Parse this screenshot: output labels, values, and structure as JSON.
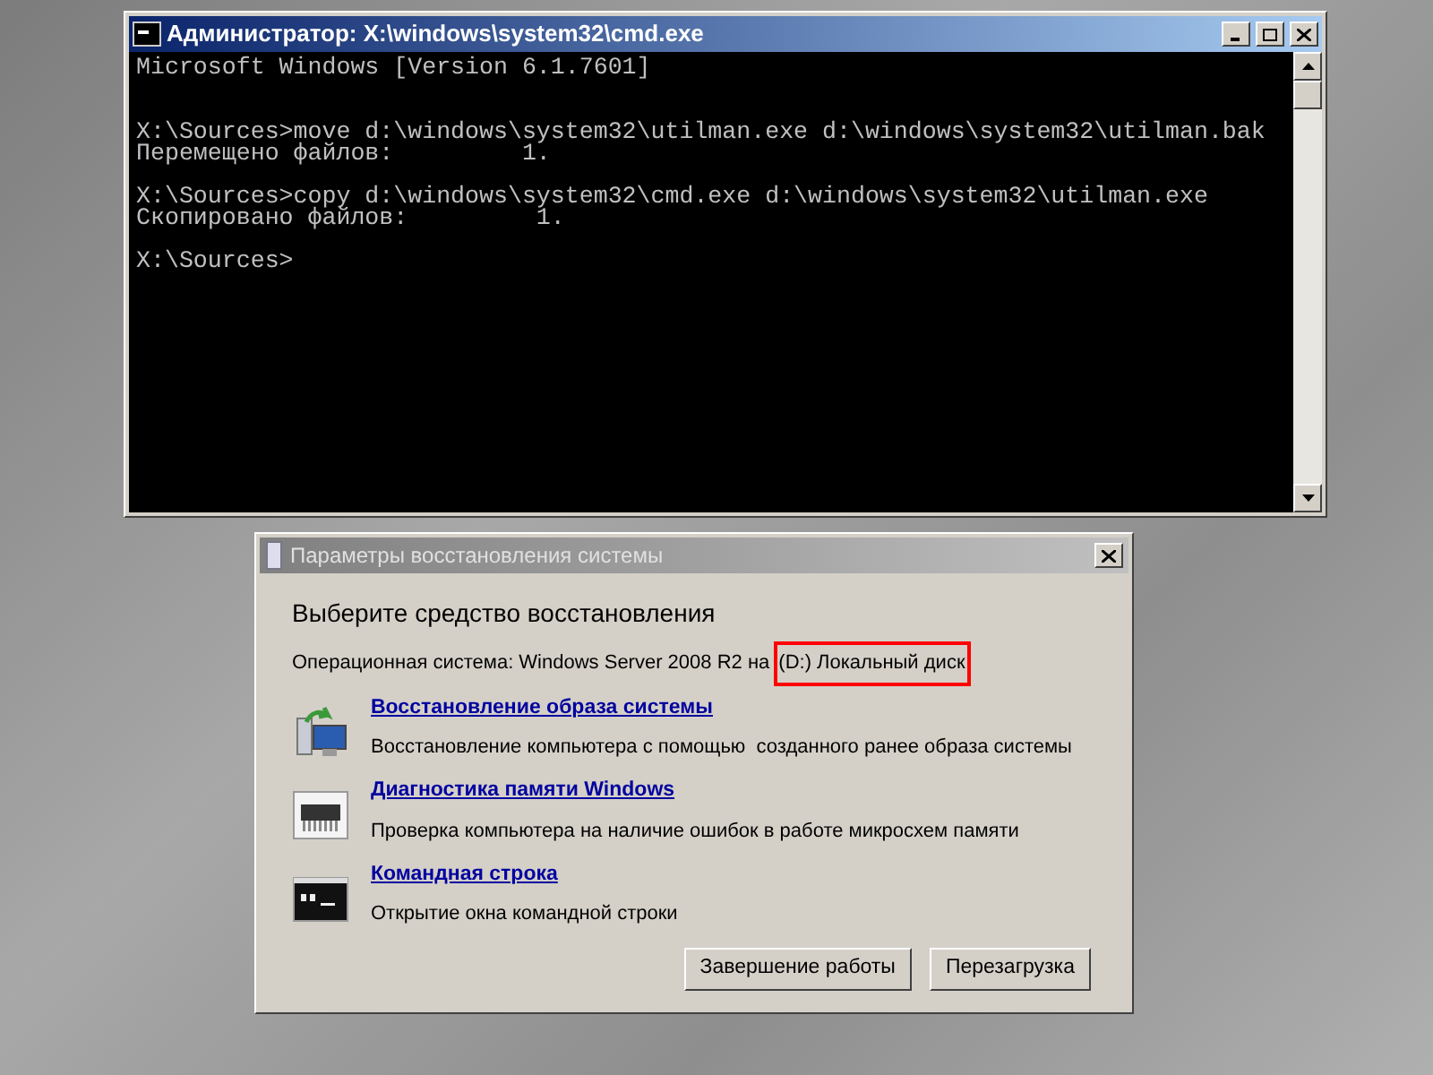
{
  "console_window": {
    "title": "Администратор: X:\\windows\\system32\\cmd.exe",
    "lines": [
      {
        "kind": "plain",
        "text": "Microsoft Windows [Version 6.1.7601]"
      },
      {
        "kind": "widespaced",
        "text": "X:\\Sources>move d:\\windows\\system32\\utilman.exe d:\\windows\\system32\\utilman.bak"
      },
      {
        "kind": "plain",
        "text": "Перемещено файлов:         1."
      },
      {
        "kind": "spaced",
        "text": "X:\\Sources>copy d:\\windows\\system32\\cmd.exe d:\\windows\\system32\\utilman.exe"
      },
      {
        "kind": "plain",
        "text": "Скопировано файлов:         1."
      },
      {
        "kind": "spaced",
        "text": "X:\\Sources>"
      }
    ]
  },
  "dialog": {
    "title": "Параметры восстановления системы",
    "heading": "Выберите средство восстановления",
    "os_line": {
      "text": "Операционная система: Windows Server 2008 R2 на",
      "highlighted": "(D:) Локальный диск"
    },
    "tools": [
      {
        "kind": "image",
        "link": "Восстановление образа системы",
        "description": "Восстановление компьютера с помощью  созданного ранее образа системы"
      },
      {
        "kind": "memory",
        "link": "Диагностика памяти Windows",
        "description": "Проверка компьютера на наличие ошибок в работе микросхем памяти"
      },
      {
        "kind": "console",
        "link": "Командная строка",
        "description": "Открытие окна командной строки"
      }
    ],
    "buttons": [
      "Завершение работы",
      "Перезагрузка"
    ]
  }
}
